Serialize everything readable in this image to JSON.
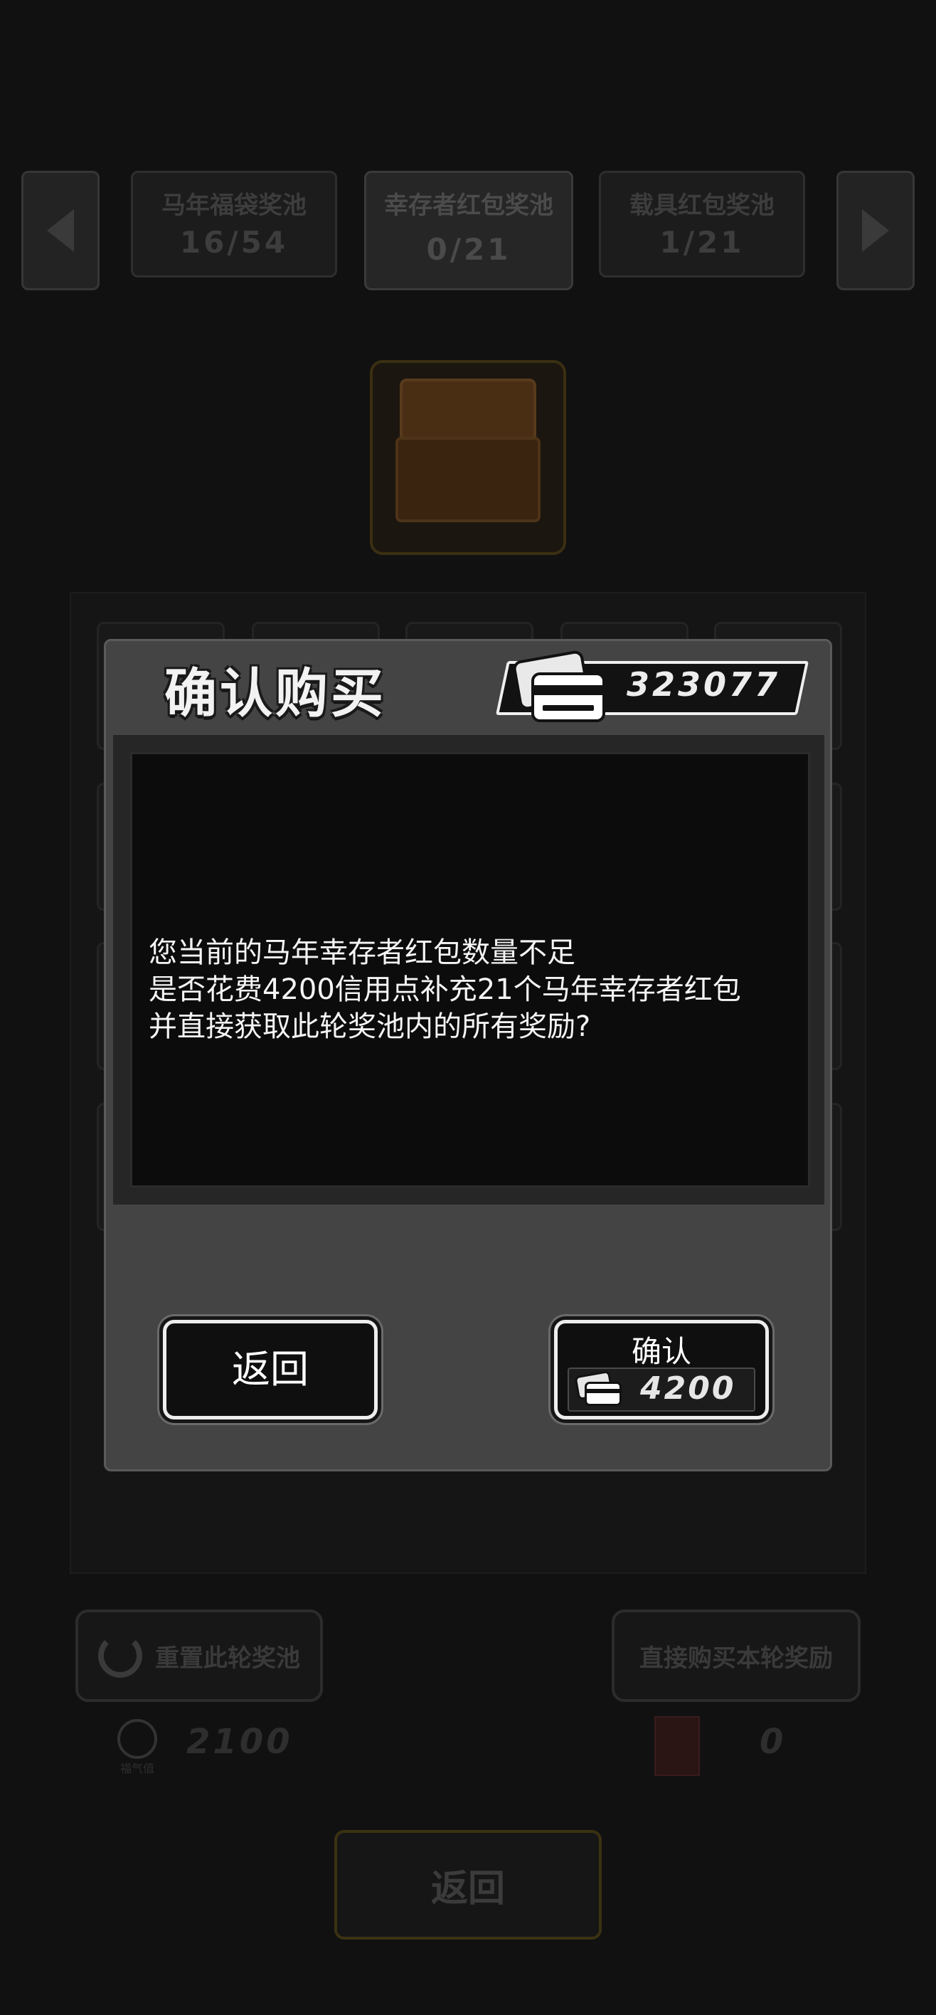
{
  "pools": [
    {
      "name": "马年福袋奖池",
      "count": "16/54"
    },
    {
      "name": "幸存者红包奖池",
      "count": "0/21"
    },
    {
      "name": "载具红包奖池",
      "count": "1/21"
    }
  ],
  "actions": {
    "reset_label": "重置此轮奖池",
    "buy_all_label": "直接购买本轮奖励"
  },
  "stats": {
    "luck_value": "2100",
    "luck_label": "福气值",
    "redpacket_value": "0"
  },
  "bottom": {
    "back_label": "返回"
  },
  "modal": {
    "title": "确认购买",
    "balance": "323077",
    "message_lines": [
      "您当前的马年幸存者红包数量不足",
      "是否花费4200信用点补充21个马年幸存者红包",
      "并直接获取此轮奖池内的所有奖励?"
    ],
    "back_label": "返回",
    "confirm_label": "确认",
    "confirm_price": "4200"
  },
  "icons": {
    "prev": "chevron-left-icon",
    "next": "chevron-right-icon",
    "chest": "treasure-chest-icon",
    "currency": "credit-card-icon",
    "reset": "refresh-icon",
    "luck": "luck-coin-icon",
    "redpacket": "red-packet-bottle-icon"
  }
}
